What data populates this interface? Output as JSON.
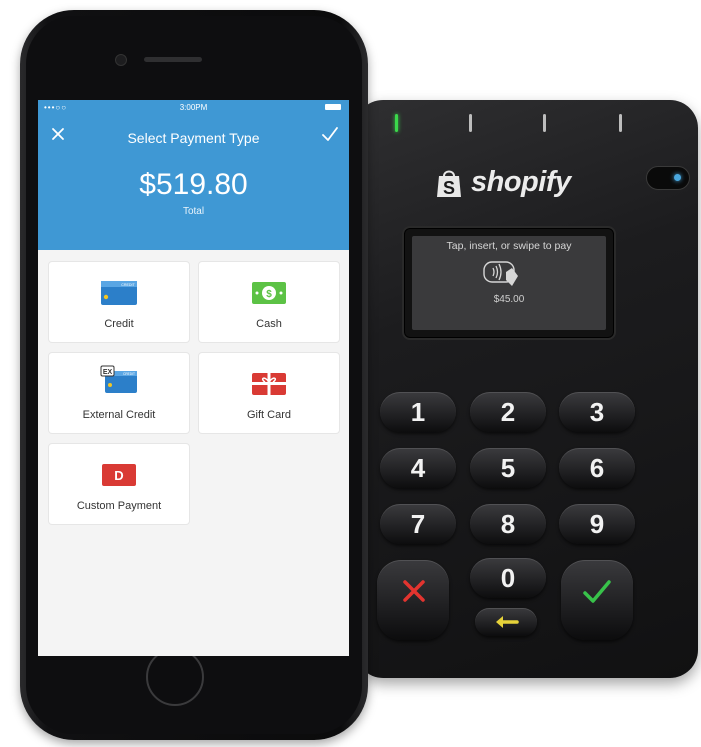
{
  "reader": {
    "brand": "shopify",
    "display_prompt": "Tap, insert, or swipe to pay",
    "display_amount": "$45.00",
    "keys": [
      "1",
      "2",
      "3",
      "4",
      "5",
      "6",
      "7",
      "8",
      "9",
      "0"
    ],
    "icons": {
      "cancel": "x-icon",
      "confirm": "check-icon",
      "back": "arrow-left-icon"
    },
    "colors": {
      "cancel": "#e3342f",
      "confirm": "#38c24a",
      "back": "#e6d23a",
      "led": "#3bd84b",
      "sensor": "#4aa8e0"
    }
  },
  "phone": {
    "status": {
      "carrier": "•••○○",
      "time": "3:00PM"
    },
    "header": {
      "title": "Select Payment Type",
      "amount": "$519.80",
      "amount_label": "Total",
      "close_icon": "close-icon",
      "confirm_icon": "check-icon",
      "color": "#3f98d4"
    },
    "payment_types": [
      {
        "label": "Credit",
        "icon": "credit-card-icon"
      },
      {
        "label": "Cash",
        "icon": "cash-icon"
      },
      {
        "label": "External Credit",
        "icon": "external-credit-card-icon",
        "badge": "EX"
      },
      {
        "label": "Gift Card",
        "icon": "gift-card-icon"
      },
      {
        "label": "Custom Payment",
        "icon": "custom-payment-icon",
        "badge": "D"
      }
    ],
    "card_word": "CREDIT"
  }
}
